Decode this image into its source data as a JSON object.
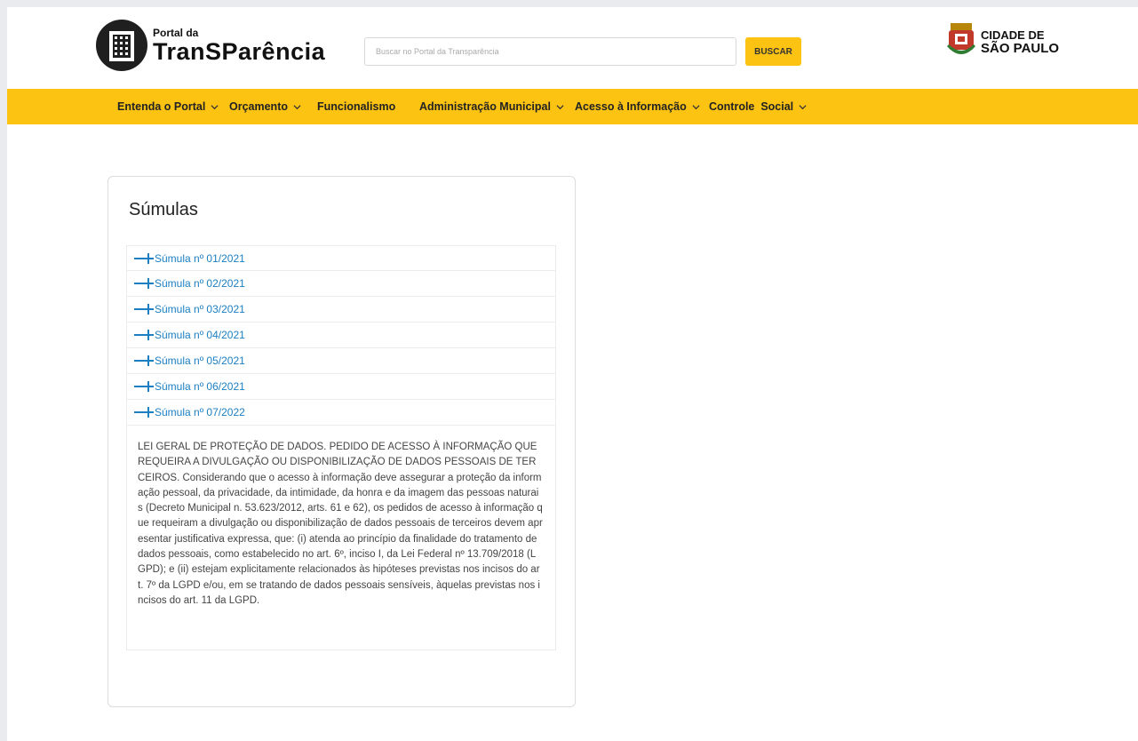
{
  "header": {
    "logo_small": "Portal da",
    "logo_big": "TranSParência",
    "search_placeholder": "Buscar no Portal da Transparência",
    "search_button": "BUSCAR",
    "city_line1": "CIDADE DE",
    "city_line2": "SÃO PAULO"
  },
  "nav": {
    "items": [
      {
        "label": "Entenda o Portal",
        "has_dropdown": true
      },
      {
        "label": "Orçamento",
        "has_dropdown": true
      },
      {
        "label": "Funcionalismo",
        "has_dropdown": false
      },
      {
        "label": "Administração Municipal",
        "has_dropdown": true
      },
      {
        "label": "Acesso à Informação",
        "has_dropdown": true
      },
      {
        "label": "Controle  Social",
        "has_dropdown": true
      }
    ]
  },
  "card": {
    "title": "Súmulas",
    "items": [
      {
        "label": "Súmula nº 01/2021"
      },
      {
        "label": "Súmula nº 02/2021"
      },
      {
        "label": "Súmula nº 03/2021"
      },
      {
        "label": "Súmula nº 04/2021"
      },
      {
        "label": "Súmula nº 05/2021"
      },
      {
        "label": "Súmula nº 06/2021"
      },
      {
        "label": "Súmula nº 07/2022"
      }
    ],
    "expanded_text": "LEI GERAL DE PROTEÇÃO DE DADOS. PEDIDO DE ACESSO À INFORMAÇÃO QUE REQUEIRA A DIVULGAÇÃO OU DISPONIBILIZAÇÃO DE DADOS PESSOAIS DE TERCEIROS. Considerando que o acesso à informação deve assegurar a proteção da informação pessoal, da privacidade, da intimidade, da honra e da imagem das pessoas naturais (Decreto Municipal n. 53.623/2012, arts. 61 e 62), os pedidos de acesso à informação que requeiram a divulgação ou disponibilização de dados pessoais de terceiros devem apresentar justificativa expressa, que: (i) atenda ao princípio da finalidade do tratamento de dados pessoais, como estabelecido no art. 6º, inciso I, da Lei Federal nº 13.709/2018 (LGPD); e (ii) estejam explicitamente relacionados às hipóteses previstas nos incisos do art. 7º da LGPD e/ou, em se tratando de dados pessoais sensíveis, àquelas previstas nos incisos do art. 11 da LGPD."
  },
  "colors": {
    "accent_yellow": "#fdc313",
    "link_blue": "#1c7fc1"
  }
}
